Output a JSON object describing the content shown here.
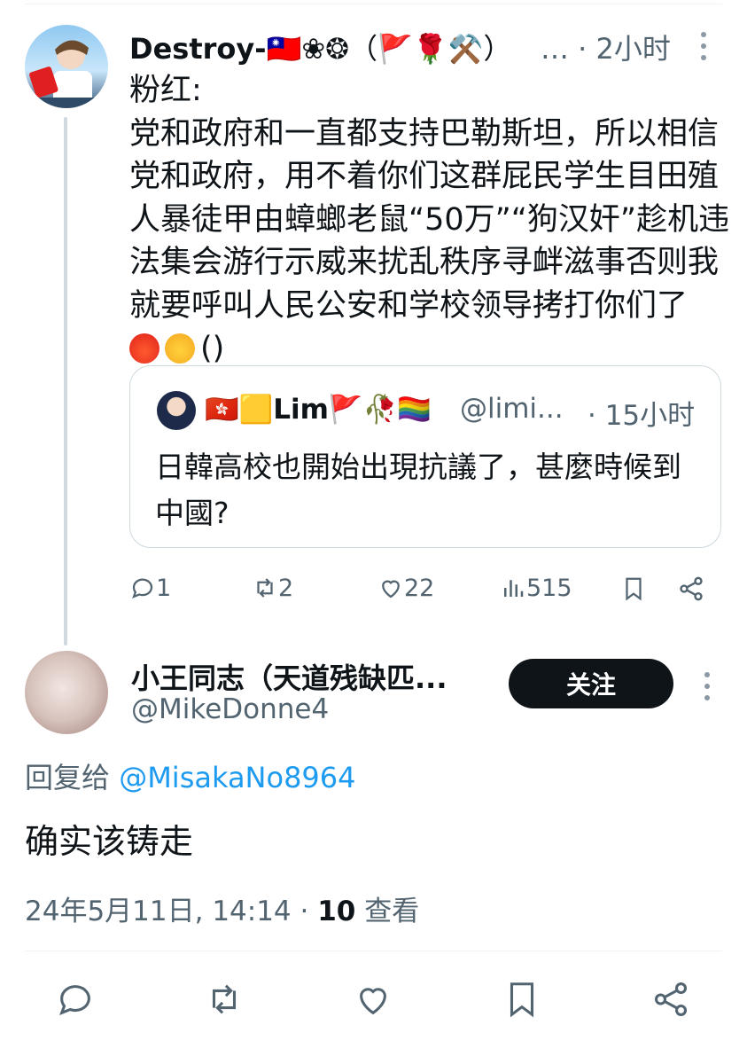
{
  "tweet": {
    "author_name": "Destroy-",
    "author_name_extra": "🇹🇼❀❂（🚩🌹⚒️）",
    "ellipsis": "…",
    "time": "· 2小时",
    "body": "粉红:\n党和政府和一直都支持巴勒斯坦，所以相信党和政府，用不着你们这群屁民学生目田殖人暴徒甲由蟑螂老鼠“50万”“狗汉奸”趁机违法集会游行示威来扰乱秩序寻衅滋事否则我就要呼叫人民公安和学校领导拷打你们了",
    "body_tail": "()",
    "emoji": [
      "angry-face",
      "steam-face"
    ],
    "quote": {
      "author_name": "🇭🇰🟨Lim🚩🥀🏳️‍🌈",
      "handle": "@limi...",
      "time": "· 15小时",
      "text": "日韓高校也開始出現抗議了，甚麼時候到中國?"
    },
    "stats": {
      "replies": "1",
      "retweets": "2",
      "likes": "22",
      "views": "515"
    }
  },
  "reply": {
    "author_name": "小王同志（天道残缺匹...",
    "handle": "@MikeDonne4",
    "follow_label": "关注",
    "reply_to_label": "回复给",
    "reply_to_handle": "@MisakaNo8964",
    "body": "确实该铸走",
    "timestamp": "24年5月11日, 14:14 · ",
    "views_count": "10",
    "views_label": " 查看"
  },
  "colors": {
    "text": "#0f1419",
    "secondary": "#536471",
    "link": "#1d9bf0",
    "border": "#cfd9de",
    "button": "#0f1419"
  },
  "icons": [
    "reply-icon",
    "retweet-icon",
    "like-icon",
    "views-icon",
    "bookmark-icon",
    "share-icon"
  ]
}
